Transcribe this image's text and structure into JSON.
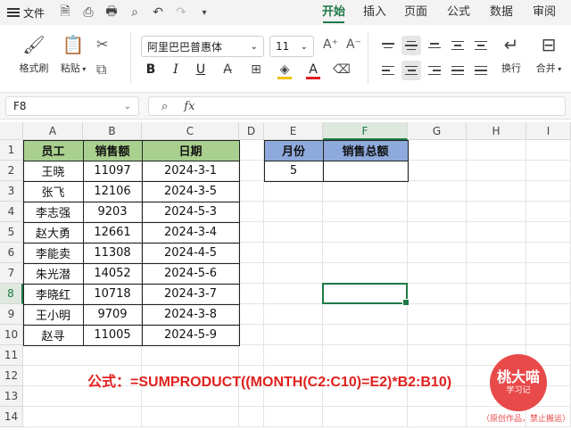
{
  "menubar": {
    "file_label": "文件",
    "tabs": [
      "开始",
      "插入",
      "页面",
      "公式",
      "数据",
      "审阅"
    ],
    "active_tab": "开始"
  },
  "ribbon": {
    "format_painter": "格式刷",
    "paste": "粘贴",
    "font_name": "阿里巴巴普惠体",
    "font_size": "11",
    "wrap": "换行",
    "merge": "合并"
  },
  "formula_bar": {
    "name_box": "F8",
    "fx_label": "fx",
    "content": ""
  },
  "columns": [
    "A",
    "B",
    "C",
    "D",
    "E",
    "F",
    "G",
    "H",
    "I"
  ],
  "active_column": "F",
  "rows": [
    "1",
    "2",
    "3",
    "4",
    "5",
    "6",
    "7",
    "8",
    "9",
    "10",
    "11",
    "12",
    "13",
    "14"
  ],
  "active_row": "8",
  "table": {
    "headers": [
      "员工",
      "销售额",
      "日期"
    ],
    "rows": [
      [
        "王晓",
        "11097",
        "2024-3-1"
      ],
      [
        "张飞",
        "12106",
        "2024-3-5"
      ],
      [
        "李志强",
        "9203",
        "2024-5-3"
      ],
      [
        "赵大勇",
        "12661",
        "2024-3-4"
      ],
      [
        "李能卖",
        "11308",
        "2024-4-5"
      ],
      [
        "朱光潜",
        "14052",
        "2024-5-6"
      ],
      [
        "李晓红",
        "10718",
        "2024-3-7"
      ],
      [
        "王小明",
        "9709",
        "2024-3-8"
      ],
      [
        "赵寻",
        "11005",
        "2024-5-9"
      ]
    ]
  },
  "lookup": {
    "month_header": "月份",
    "total_header": "销售总额",
    "month_value": "5",
    "total_value": ""
  },
  "annotation": {
    "formula_text": "公式：=SUMPRODUCT((MONTH(C2:C10)=E2)*B2:B10)"
  },
  "logo": {
    "line1": "桃大喵",
    "line2": "学习记",
    "watermark": "（原创作品，禁止搬运）"
  },
  "colors": {
    "accent": "#1d7a46",
    "header_green": "#a9d08e",
    "header_blue": "#8ea9db",
    "formula_red": "#e0211e"
  }
}
